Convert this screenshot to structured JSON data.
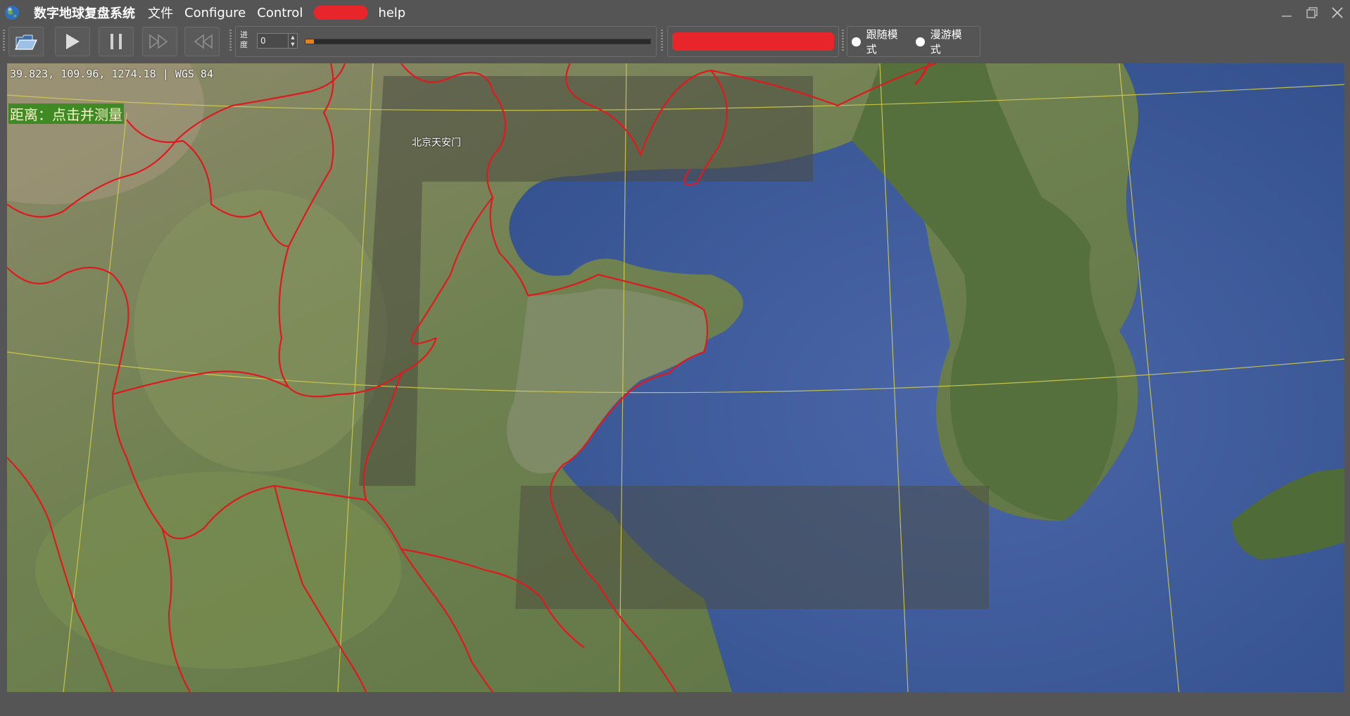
{
  "app": {
    "title": "数字地球复盘系统",
    "menu": [
      "文件",
      "Configure",
      "Control",
      "help"
    ]
  },
  "toolbar": {
    "open_icon": "folder-open-icon",
    "play_icon": "play-icon",
    "pause_icon": "pause-icon",
    "forward_icon": "fast-forward-icon",
    "rewind_icon": "rewind-icon",
    "progress_label": "进度",
    "progress_value": "0",
    "progress_fraction": 0.025,
    "modes": [
      "跟随模式",
      "漫游模式"
    ]
  },
  "map": {
    "coord_readout": "39.823, 109.96, 1274.18  |  WGS 84",
    "measure_label": "距离：点击并测量",
    "place_label": "北京天安门"
  },
  "colors": {
    "border": "#e8252a",
    "progress_fill": "#e87f1f",
    "sea": "#3f5f9e",
    "grid": "#d8d04a",
    "measure_bg": "#3f8a24"
  }
}
